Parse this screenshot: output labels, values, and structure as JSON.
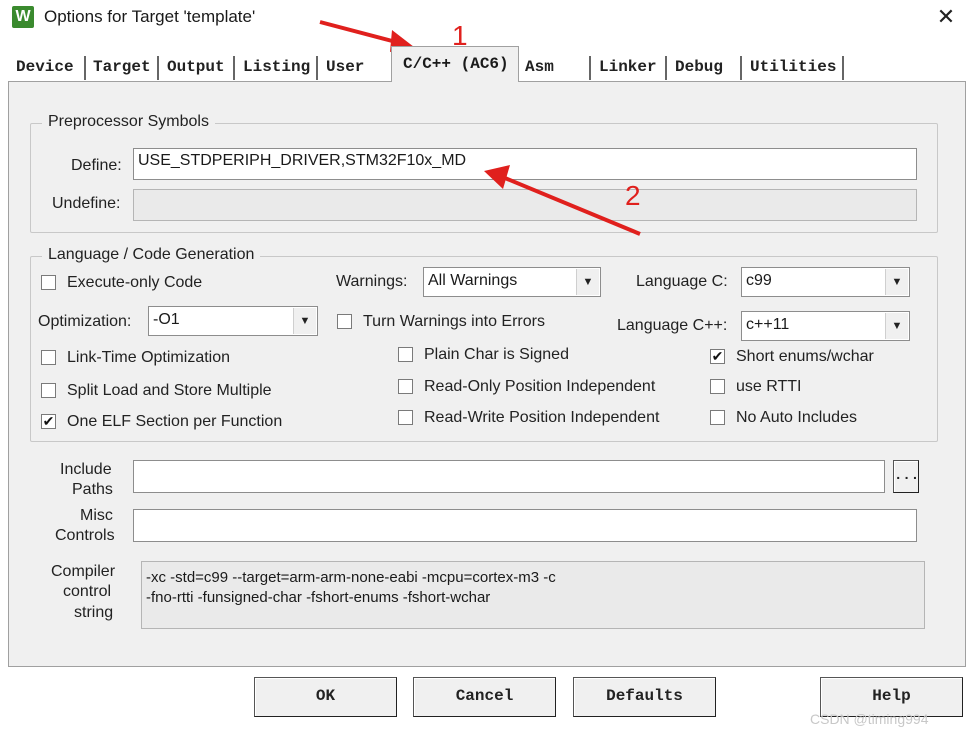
{
  "window": {
    "title": "Options for Target 'template'",
    "close_glyph": "✕",
    "app_icon_glyph": "W"
  },
  "tabs": [
    {
      "label": "Device"
    },
    {
      "label": "Target"
    },
    {
      "label": "Output"
    },
    {
      "label": "Listing"
    },
    {
      "label": "User"
    },
    {
      "label": "C/C++ (AC6)",
      "active": true
    },
    {
      "label": "Asm"
    },
    {
      "label": "Linker"
    },
    {
      "label": "Debug"
    },
    {
      "label": "Utilities"
    }
  ],
  "preprocessor": {
    "title": "Preprocessor Symbols",
    "define_label": "Define:",
    "define_value": "USE_STDPERIPH_DRIVER,STM32F10x_MD",
    "undefine_label": "Undefine:",
    "undefine_value": ""
  },
  "language": {
    "title": "Language / Code Generation",
    "execute_only": {
      "label": "Execute-only Code",
      "checked": false
    },
    "optimization_label": "Optimization:",
    "optimization_value": "-O1",
    "link_time": {
      "label": "Link-Time Optimization",
      "checked": false
    },
    "split_load": {
      "label": "Split Load and Store Multiple",
      "checked": false
    },
    "one_elf": {
      "label": "One ELF Section per Function",
      "checked": true
    },
    "warnings_label": "Warnings:",
    "warnings_value": "All Warnings",
    "turn_warnings": {
      "label": "Turn Warnings into Errors",
      "checked": false
    },
    "plain_char": {
      "label": "Plain Char is Signed",
      "checked": false
    },
    "ropi": {
      "label": "Read-Only Position Independent",
      "checked": false
    },
    "rwpi": {
      "label": "Read-Write Position Independent",
      "checked": false
    },
    "language_c_label": "Language C:",
    "language_c_value": "c99",
    "language_cpp_label": "Language C++:",
    "language_cpp_value": "c++11",
    "short_enums": {
      "label": "Short enums/wchar",
      "checked": true
    },
    "use_rtti": {
      "label": "use RTTI",
      "checked": false
    },
    "no_auto_includes": {
      "label": "No Auto Includes",
      "checked": false
    }
  },
  "include_paths": {
    "label_line1": "Include",
    "label_line2": "Paths",
    "value": "",
    "browse_label": "..."
  },
  "misc_controls": {
    "label_line1": "Misc",
    "label_line2": "Controls",
    "value": ""
  },
  "compiler_string": {
    "label_line1": "Compiler",
    "label_line2": "control",
    "label_line3": "string",
    "line1": "-xc -std=c99 --target=arm-arm-none-eabi -mcpu=cortex-m3 -c",
    "line2": "-fno-rtti -funsigned-char -fshort-enums -fshort-wchar"
  },
  "buttons": {
    "ok": "OK",
    "cancel": "Cancel",
    "defaults": "Defaults",
    "help": "Help"
  },
  "annotations": {
    "num1": "1",
    "num2": "2",
    "color": "#e0201d"
  },
  "watermark": "CSDN @timing994"
}
